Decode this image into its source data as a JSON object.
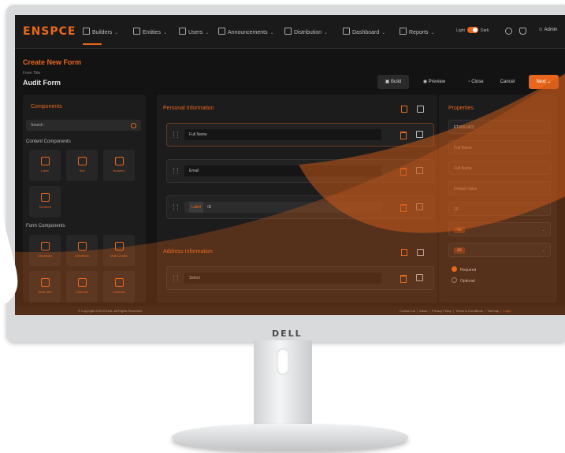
{
  "brand": {
    "logo": "ENSPCE",
    "accent": "#e8671c",
    "monitor_brand": "DELL"
  },
  "nav": {
    "items": [
      {
        "label": "Builders",
        "icon": "builder-icon"
      },
      {
        "label": "Entities",
        "icon": "entities-icon"
      },
      {
        "label": "Users",
        "icon": "users-icon"
      },
      {
        "label": "Announcements",
        "icon": "announcement-icon"
      },
      {
        "label": "Distribution",
        "icon": "distribution-icon"
      },
      {
        "label": "Dashboard",
        "icon": "dashboard-icon"
      },
      {
        "label": "Reports",
        "icon": "reports-icon"
      }
    ],
    "theme_light": "Light",
    "theme_dark": "Dark",
    "user": "Admin"
  },
  "header": {
    "title": "Create New Form",
    "form_title_label": "Form Title",
    "form_title_value": "Audit Form",
    "buttons": {
      "build": "Build",
      "preview": "Preview",
      "close": "Close",
      "cancel": "Cancel",
      "next": "Next"
    }
  },
  "components_panel": {
    "title": "Components",
    "search_placeholder": "Search",
    "content_heading": "Content Components",
    "content_items": [
      "Label",
      "Text",
      "Numeric",
      "Textarea"
    ],
    "form_heading": "Form Components",
    "form_items": [
      "Dropdown",
      "Checkbox",
      "Multi Choice",
      "Radio Btn",
      "Calendar",
      "Calendar"
    ]
  },
  "form_canvas": {
    "sections": [
      {
        "title": "Personal Information",
        "fields": [
          "Full Name",
          "Email",
          "ID"
        ],
        "id_tag": "Label"
      },
      {
        "title": "Address Information",
        "fields": [
          "Select"
        ]
      }
    ]
  },
  "properties": {
    "title": "Properties",
    "fields": [
      "FT4561423",
      "Full Name",
      "Full Name",
      "Default Value",
      "25"
    ],
    "pill_1": "All",
    "pill_2": "All",
    "required": "Required",
    "optional": "Optional"
  },
  "footer": {
    "copyright": "© Copyright 2023 ECDA. All Rights Reserved.",
    "links": [
      "Contact Us",
      "About",
      "Privacy Policy",
      "Terms & Conditions",
      "Sitemap"
    ],
    "highlight": "Login"
  }
}
